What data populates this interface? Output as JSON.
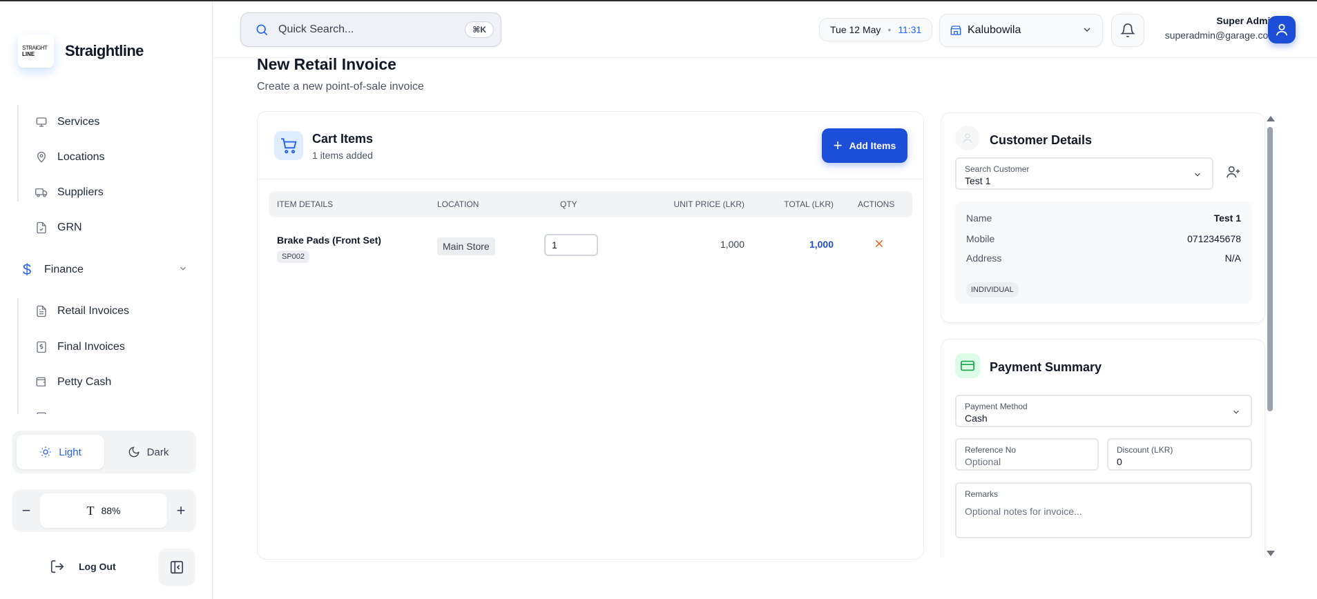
{
  "brand": {
    "logo_line1": "STRAIGHT",
    "logo_line2": "LINE",
    "name": "Straightline"
  },
  "sidebar": {
    "items": [
      {
        "label": "Services",
        "icon": "monitor-settings-icon"
      },
      {
        "label": "Locations",
        "icon": "map-pin-icon"
      },
      {
        "label": "Suppliers",
        "icon": "truck-icon"
      },
      {
        "label": "GRN",
        "icon": "file-check-icon"
      }
    ],
    "finance_group": {
      "label": "Finance",
      "icon": "dollar-icon"
    },
    "finance_items": [
      {
        "label": "Retail Invoices",
        "icon": "file-text-icon"
      },
      {
        "label": "Final Invoices",
        "icon": "dollar-file-icon"
      },
      {
        "label": "Petty Cash",
        "icon": "wallet-icon"
      }
    ],
    "theme": {
      "light": "Light",
      "dark": "Dark",
      "active": "Light"
    },
    "zoom": {
      "minus": "−",
      "glyph": "T",
      "value": "88%",
      "plus": "+"
    },
    "logout": "Log Out"
  },
  "header": {
    "search_placeholder": "Quick Search...",
    "search_shortcut": "⌘K",
    "date": "Tue 12 May",
    "time": "11:31",
    "location": "Kalubowila",
    "user_name": "Super Admin",
    "user_email": "superadmin@garage.com"
  },
  "page": {
    "title": "New Retail Invoice",
    "subtitle": "Create a new point-of-sale invoice"
  },
  "cart": {
    "title": "Cart Items",
    "subtitle": "1 items added",
    "add_label": "Add Items",
    "columns": {
      "item": "ITEM DETAILS",
      "location": "LOCATION",
      "qty": "QTY",
      "unit_price": "UNIT PRICE (LKR)",
      "total": "TOTAL (LKR)",
      "actions": "ACTIONS"
    },
    "rows": [
      {
        "name": "Brake Pads (Front Set)",
        "sku": "SP002",
        "location": "Main Store",
        "qty": "1",
        "unit_price": "1,000",
        "total": "1,000"
      }
    ]
  },
  "customer": {
    "title": "Customer Details",
    "search_label": "Search Customer",
    "search_value": "Test 1",
    "name_label": "Name",
    "name": "Test 1",
    "mobile_label": "Mobile",
    "mobile": "0712345678",
    "address_label": "Address",
    "address": "N/A",
    "type": "INDIVIDUAL"
  },
  "payment": {
    "title": "Payment Summary",
    "method_label": "Payment Method",
    "method": "Cash",
    "ref_label": "Reference No",
    "ref_placeholder": "Optional",
    "discount_label": "Discount (LKR)",
    "discount": "0",
    "remarks_label": "Remarks",
    "remarks_placeholder": "Optional notes for invoice..."
  },
  "colors": {
    "primary": "#1d4ed8",
    "accent": "#2563eb",
    "danger": "#ea580c",
    "success_bg": "#dcfce7"
  }
}
